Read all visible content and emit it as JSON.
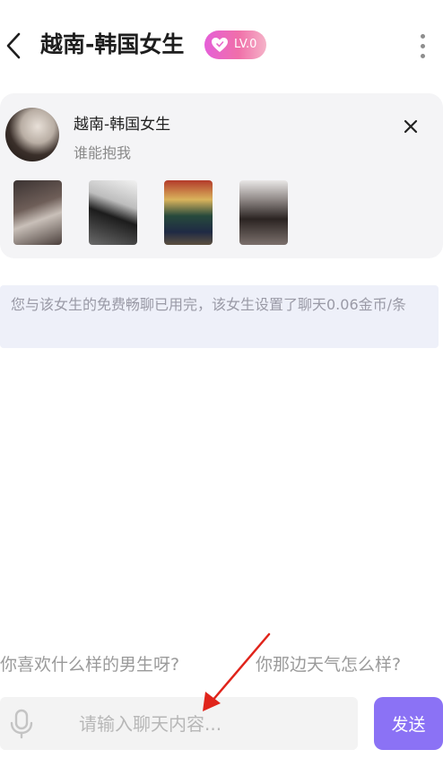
{
  "header": {
    "title": "越南-韩国女生",
    "level_badge": "LV.0"
  },
  "profile": {
    "name": "越南-韩国女生",
    "bio": "谁能抱我"
  },
  "notice": {
    "text": "您与该女生的免费畅聊已用完，该女生设置了聊天0.06金币/条"
  },
  "quick_replies": [
    "你喜欢什么样的男生呀?",
    "你那边天气怎么样?"
  ],
  "input": {
    "placeholder": "请输入聊天内容...",
    "value": ""
  },
  "send_button": {
    "label": "发送"
  },
  "colors": {
    "accent": "#8b72f5",
    "badge_start": "#e55fd8",
    "badge_end": "#f5b3c8",
    "annotation": "#e0241b"
  }
}
